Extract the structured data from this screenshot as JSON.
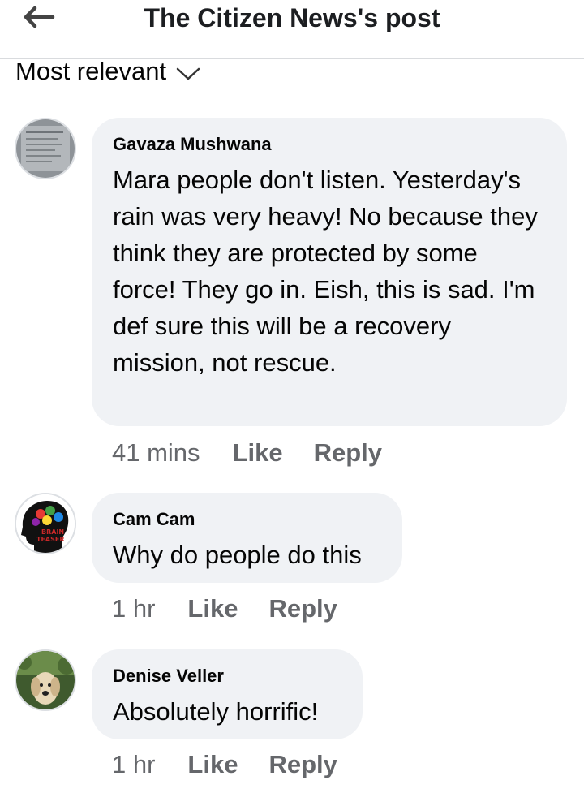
{
  "header": {
    "title": "The Citizen News's post"
  },
  "sort": {
    "label": "Most relevant"
  },
  "comments": [
    {
      "author": "Gavaza Mushwana",
      "text": "Mara people don't listen. Yesterday's rain was very heavy! No because they think they are protected by some force! They go in. Eish, this is sad. I'm def sure this will be a recovery mission, not rescue.",
      "time": "41 mins",
      "like_label": "Like",
      "reply_label": "Reply"
    },
    {
      "author": "Cam Cam",
      "text": "Why do people do this",
      "time": "1 hr",
      "like_label": "Like",
      "reply_label": "Reply",
      "avatar_text": "BRAIN TEASER"
    },
    {
      "author": "Denise Veller",
      "text": "Absolutely horrific!",
      "time": "1 hr",
      "like_label": "Like",
      "reply_label": "Reply"
    }
  ]
}
